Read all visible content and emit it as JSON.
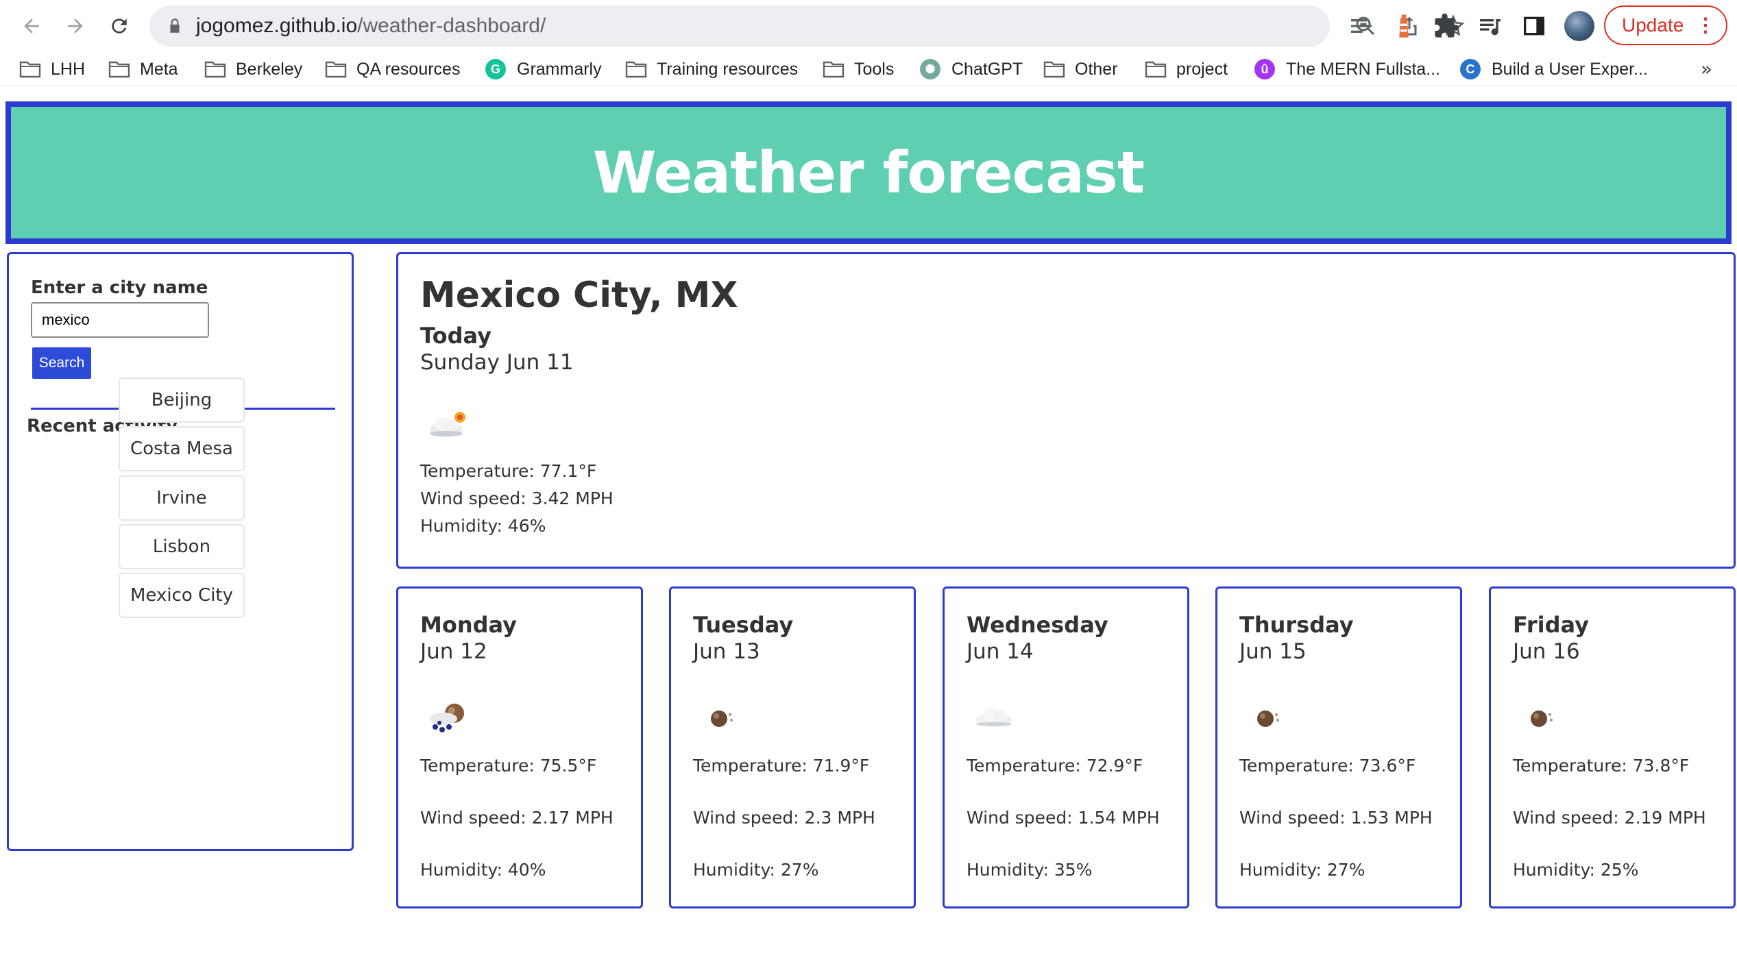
{
  "browser": {
    "url_host": "jogomez.github.io",
    "url_path": "/weather-dashboard/",
    "update_label": "Update",
    "bookmarks": [
      {
        "label": "LHH",
        "icon": "folder-icon"
      },
      {
        "label": "Meta",
        "icon": "folder-icon"
      },
      {
        "label": "Berkeley",
        "icon": "folder-icon"
      },
      {
        "label": "QA resources",
        "icon": "folder-icon"
      },
      {
        "label": "Grammarly",
        "icon": "grammarly-icon"
      },
      {
        "label": "Training resources",
        "icon": "folder-icon"
      },
      {
        "label": "Tools",
        "icon": "folder-icon"
      },
      {
        "label": "ChatGPT",
        "icon": "chatgpt-icon"
      },
      {
        "label": "Other",
        "icon": "folder-icon"
      },
      {
        "label": "project",
        "icon": "folder-icon"
      },
      {
        "label": "The MERN Fullsta...",
        "icon": "udemy-icon"
      },
      {
        "label": "Build a User Exper...",
        "icon": "coursera-icon"
      }
    ],
    "more_bookmarks": "»"
  },
  "header": {
    "title": "Weather forecast"
  },
  "sidebar": {
    "search_label": "Enter a city name",
    "search_value": "mexico",
    "search_button": "Search",
    "recent_label": "Recent activity",
    "recent": [
      "Beijing",
      "Costa Mesa",
      "Irvine",
      "Lisbon",
      "Mexico City"
    ]
  },
  "today": {
    "city": "Mexico City, MX",
    "label": "Today",
    "date": "Sunday Jun 11",
    "icon": "few-clouds-icon",
    "temperature": "Temperature: 77.1°F",
    "wind": "Wind speed: 3.42 MPH",
    "humidity": "Humidity: 46%"
  },
  "forecast": [
    {
      "day": "Monday",
      "date": "Jun 12",
      "icon": "rain-icon",
      "temperature": "Temperature: 75.5°F",
      "wind": "Wind speed: 2.17 MPH",
      "humidity": "Humidity: 40%"
    },
    {
      "day": "Tuesday",
      "date": "Jun 13",
      "icon": "clear-sky-icon",
      "temperature": "Temperature: 71.9°F",
      "wind": "Wind speed: 2.3 MPH",
      "humidity": "Humidity: 27%"
    },
    {
      "day": "Wednesday",
      "date": "Jun 14",
      "icon": "cloud-icon",
      "temperature": "Temperature: 72.9°F",
      "wind": "Wind speed: 1.54 MPH",
      "humidity": "Humidity: 35%"
    },
    {
      "day": "Thursday",
      "date": "Jun 15",
      "icon": "clear-sky-icon",
      "temperature": "Temperature: 73.6°F",
      "wind": "Wind speed: 1.53 MPH",
      "humidity": "Humidity: 27%"
    },
    {
      "day": "Friday",
      "date": "Jun 16",
      "icon": "clear-sky-icon",
      "temperature": "Temperature: 73.8°F",
      "wind": "Wind speed: 2.19 MPH",
      "humidity": "Humidity: 25%"
    }
  ],
  "colors": {
    "accent": "#2d3ad1",
    "header_bg": "#5fcfb1",
    "button": "#2d4bd6",
    "update": "#d93025"
  }
}
